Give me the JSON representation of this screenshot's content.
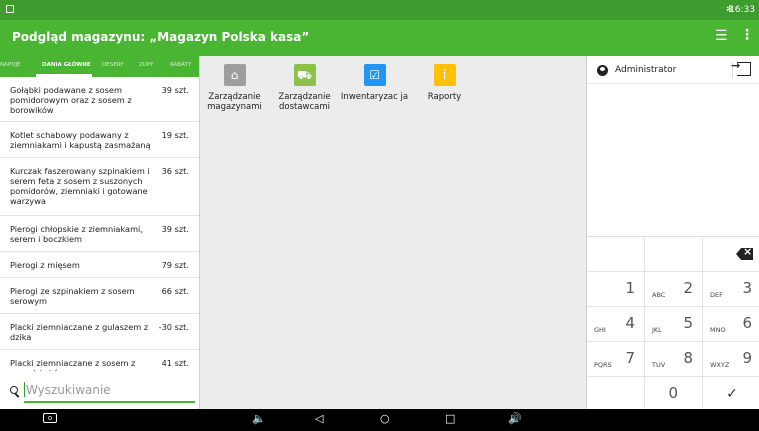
{
  "status_bar": {
    "time": "16:33",
    "bluetooth": "✻"
  },
  "app_bar": {
    "title": "Podgląd magazynu: „Magazyn Polska kasa”",
    "filter_icon": "filter-icon",
    "more_icon": "more-vert-icon"
  },
  "tabs": [
    "NAPOJE",
    "DANIA GŁÓWNE",
    "DESERY",
    "ZUPY",
    "RABATY"
  ],
  "active_tab": 1,
  "items": [
    {
      "name": "Gołąbki podawane z sosem pomidorowym oraz z sosem z borowików",
      "qty": "39 szt."
    },
    {
      "name": "Kotlet schabowy podawany z ziemniakami i kapustą zasmażaną",
      "qty": "19 szt."
    },
    {
      "name": "Kurczak faszerowany szpinakiem i serem feta z sosem z suszonych pomidorów, ziemniaki i gotowane warzywa",
      "qty": "36 szt."
    },
    {
      "name": "Pierogi chłopskie z ziemniakami, serem i boczkiem",
      "qty": "39 szt."
    },
    {
      "name": "Pierogi z mięsem",
      "qty": "79 szt."
    },
    {
      "name": "Pierogi ze szpinakiem z sosem serowym",
      "qty": "66 szt."
    },
    {
      "name": "Placki ziemniaczane z gulaszem z dzika",
      "qty": "-30 szt."
    },
    {
      "name": "Placki ziemniaczane z sosem z prawdziwków",
      "qty": "41 szt."
    }
  ],
  "search": {
    "placeholder": "Wyszukiwanie"
  },
  "tiles": [
    {
      "label": "Zarządzanie magazynami",
      "icon": "home-icon",
      "color": "#9e9e9e"
    },
    {
      "label": "Zarządzanie dostawcami",
      "icon": "forklift-icon",
      "color": "#8bc34a"
    },
    {
      "label": "Inwentaryzac ja",
      "icon": "checkbox-icon",
      "color": "#2196f3"
    },
    {
      "label": "Raporty",
      "icon": "info-icon",
      "color": "#ffc107"
    }
  ],
  "user": {
    "name": "Administrator",
    "logout_icon": "logout-icon"
  },
  "keypad": {
    "keys": [
      {
        "digit": "",
        "letters": ""
      },
      {
        "digit": "",
        "letters": ""
      },
      {
        "digit": "⌫",
        "letters": ""
      },
      {
        "digit": "1",
        "letters": ""
      },
      {
        "digit": "2",
        "letters": "ABC"
      },
      {
        "digit": "3",
        "letters": "DEF"
      },
      {
        "digit": "4",
        "letters": "GHI"
      },
      {
        "digit": "5",
        "letters": "JKL"
      },
      {
        "digit": "6",
        "letters": "MNO"
      },
      {
        "digit": "7",
        "letters": "PQRS"
      },
      {
        "digit": "8",
        "letters": "TUV"
      },
      {
        "digit": "9",
        "letters": "WXYZ"
      },
      {
        "digit": "",
        "letters": ""
      },
      {
        "digit": "0",
        "letters": ""
      },
      {
        "digit": "✓",
        "letters": ""
      }
    ]
  },
  "colors": {
    "primary": "#49b533",
    "status": "#3f9c2f"
  }
}
